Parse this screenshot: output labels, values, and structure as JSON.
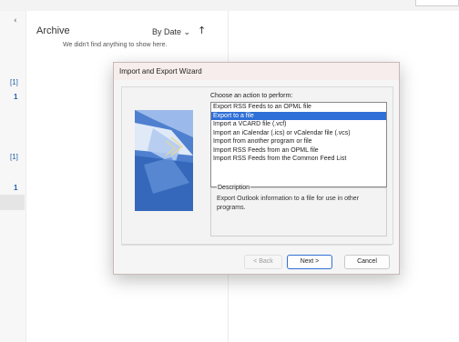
{
  "list": {
    "folder_title": "Archive",
    "sort_label": "By Date",
    "sort_chevron": "⌄",
    "sort_direction": "↑",
    "empty_message": "We didn't find anything to show here."
  },
  "rail": {
    "collapse_glyph": "‹",
    "badges": [
      "[1]",
      "1",
      "[1]",
      "1"
    ]
  },
  "wizard": {
    "title": "Import and Export Wizard",
    "prompt": "Choose an action to perform:",
    "options": [
      "Export RSS Feeds to an OPML file",
      "Export to a file",
      "Import a VCARD file (.vcf)",
      "Import an iCalendar (.ics) or vCalendar file (.vcs)",
      "Import from another program or file",
      "Import RSS Feeds from an OPML file",
      "Import RSS Feeds from the Common Feed List"
    ],
    "selected_index": 1,
    "description_label": "Description",
    "description_text": "Export Outlook information to a file for use in other programs.",
    "back_label": "< Back",
    "next_label": "Next >",
    "cancel_label": "Cancel"
  },
  "colors": {
    "accent": "#2f6fd6",
    "badge": "#1f5fa8",
    "wizard_art": "#3e6fc0"
  }
}
